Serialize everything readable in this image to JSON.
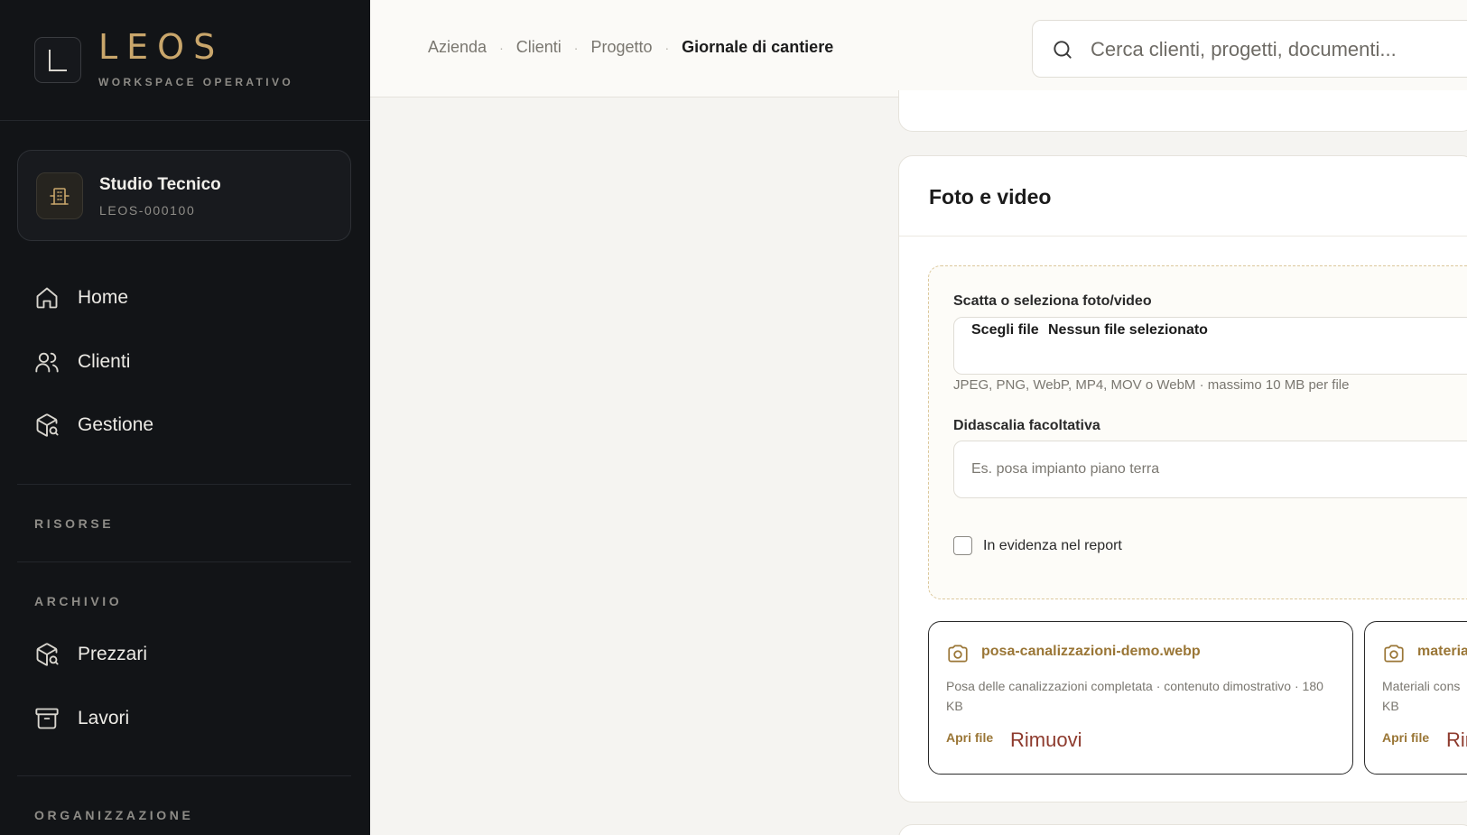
{
  "brand": {
    "name": "LEOS",
    "subtitle": "WORKSPACE OPERATIVO"
  },
  "workspace": {
    "name": "Studio Tecnico",
    "code": "LEOS-000100",
    "icon": "building-icon"
  },
  "nav": {
    "main": [
      {
        "label": "Home",
        "icon": "home-icon"
      },
      {
        "label": "Clienti",
        "icon": "users-icon"
      },
      {
        "label": "Gestione",
        "icon": "package-search-icon"
      }
    ],
    "sections": {
      "risorse": "RISORSE",
      "archivio": "ARCHIVIO",
      "organizzazione": "ORGANIZZAZIONE"
    },
    "archivio": [
      {
        "label": "Prezzari",
        "icon": "package-search-icon"
      },
      {
        "label": "Lavori",
        "icon": "archive-icon"
      }
    ]
  },
  "breadcrumb": [
    "Azienda",
    "Clienti",
    "Progetto",
    "Giornale di cantiere"
  ],
  "search": {
    "placeholder": "Cerca clienti, progetti, documenti..."
  },
  "media_section": {
    "title": "Foto e video",
    "upload_label": "Scatta o seleziona foto/video",
    "choose_file": "Scegli file",
    "no_file": "Nessun file selezionato",
    "hint": "JPEG, PNG, WebP, MP4, MOV o WebM · massimo 10 MB per file",
    "caption_label": "Didascalia facoltativa",
    "caption_placeholder": "Es. posa impianto piano terra",
    "highlight_label": "In evidenza nel report",
    "files": [
      {
        "name": "posa-canalizzazioni-demo.webp",
        "description": "Posa delle canalizzazioni completata · contenuto dimostrativo · 180 KB",
        "open_label": "Apri file",
        "remove_label": "Rimuovi"
      },
      {
        "name": "materia",
        "description": "Materiali cons KB",
        "open_label": "Apri file",
        "remove_label": "Rir"
      }
    ]
  },
  "colors": {
    "accent": "#c9a66b",
    "link": "#9a7636",
    "danger": "#8e3b2e",
    "sidebar_bg": "#121417"
  }
}
